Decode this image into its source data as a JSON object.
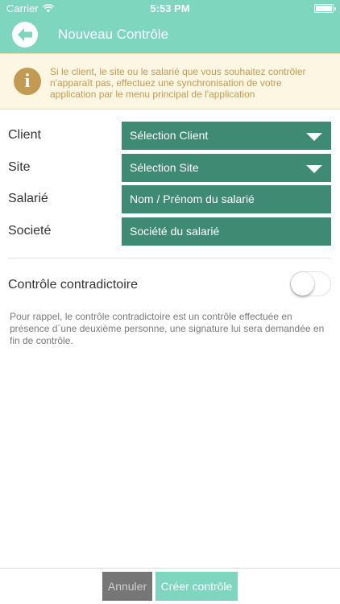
{
  "status_bar": {
    "carrier": "Carrier",
    "time": "5:53 PM",
    "wifi_icon": "wifi-icon",
    "battery_icon": "battery-icon",
    "battery_level": 1.0
  },
  "nav": {
    "title": "Nouveau Contrôle",
    "back_icon": "arrow-left-icon"
  },
  "info": {
    "icon": "info-icon",
    "icon_glyph": "i",
    "message": "Si le client, le site ou le salarié que vous souhaitez contrôler n'apparaît pas, effectuez une synchronisation de votre application par le menu principal de l'application"
  },
  "form": {
    "client": {
      "label": "Client",
      "value": "Sélection Client"
    },
    "site": {
      "label": "Site",
      "value": "Sélection Site"
    },
    "salarie": {
      "label": "Salarié",
      "placeholder": "Nom / Prénom du salarié"
    },
    "societe": {
      "label": "Societé",
      "placeholder": "Société du salarié"
    }
  },
  "toggle": {
    "label": "Contrôle contradictoire",
    "on": false
  },
  "note": "Pour rappel, le contrôle contradictoire est un contrôle effectuée en présence d´une deuxième personne, une signature lui sera demandée en fin de contrôle.",
  "footer": {
    "cancel_label": "Annuler",
    "create_label": "Créer contrôle"
  },
  "colors": {
    "primary": "#7dd6bd",
    "field": "#3f8a72",
    "info_bg": "#fdf6e3",
    "info_text": "#c39a53",
    "cancel": "#767676"
  }
}
